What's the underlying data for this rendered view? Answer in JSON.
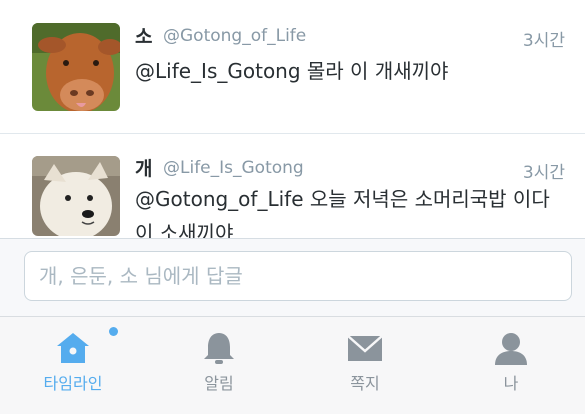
{
  "tweets": [
    {
      "name": "소",
      "handle": "@Gotong_of_Life",
      "time": "3시간",
      "text": "@Life_Is_Gotong 몰라 이 개새끼야",
      "avatar": "cow-photo"
    },
    {
      "name": "개",
      "handle": "@Life_Is_Gotong",
      "time": "3시간",
      "text": "@Gotong_of_Life 오늘 저녁은 소머리국밥 이다 이 소새끼야",
      "avatar": "dog-photo"
    }
  ],
  "reply": {
    "placeholder": "개, 은둔, 소 님에게 답글"
  },
  "tabs": [
    {
      "label": "타임라인",
      "icon": "home-icon",
      "active": true,
      "notification_dot": true
    },
    {
      "label": "알림",
      "icon": "bell-icon",
      "active": false
    },
    {
      "label": "쪽지",
      "icon": "envelope-icon",
      "active": false
    },
    {
      "label": "나",
      "icon": "person-icon",
      "active": false
    }
  ],
  "colors": {
    "accent": "#55acee",
    "inactive": "#8b949c",
    "meta": "#8899a6",
    "text": "#292f33"
  }
}
